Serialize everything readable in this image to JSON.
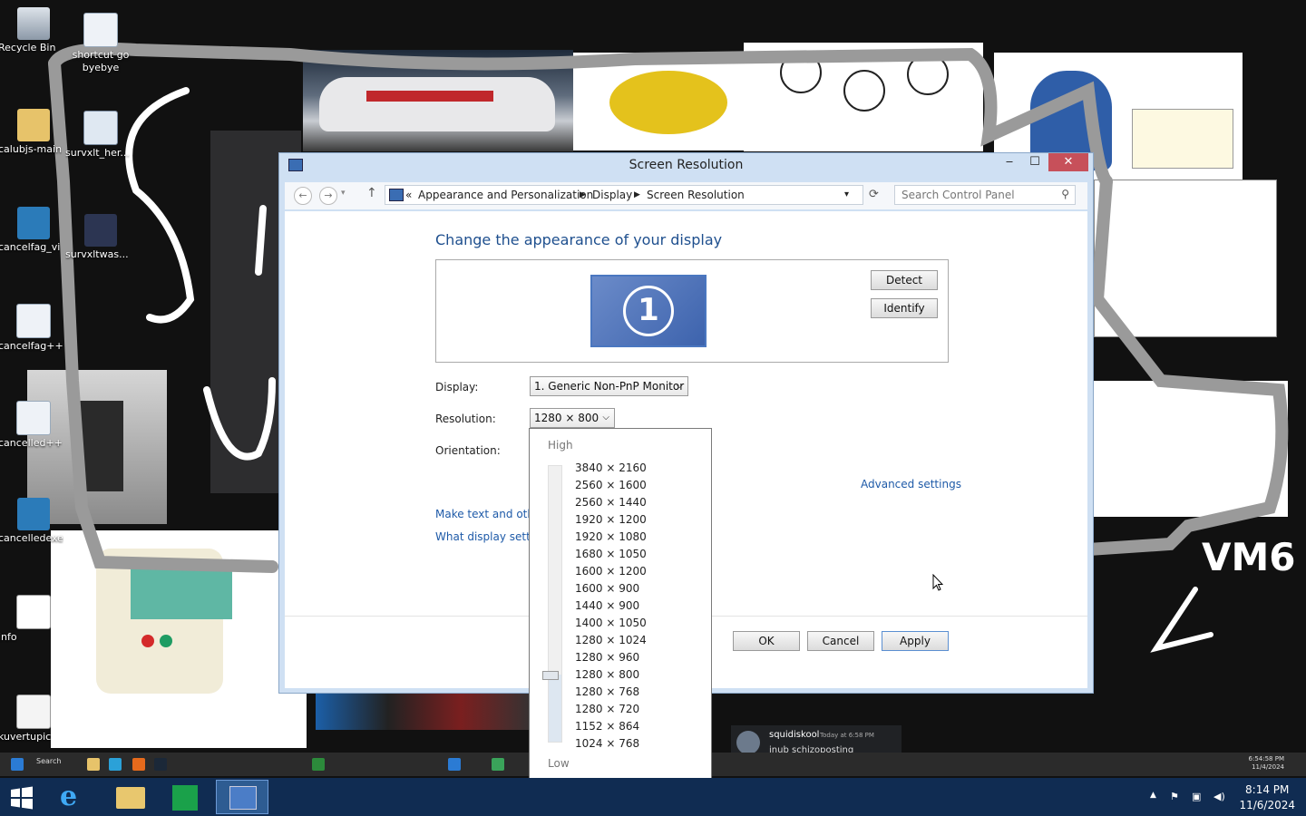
{
  "desktop": {
    "icons": [
      {
        "label": "Recycle Bin",
        "icon": "recycle-bin-icon"
      },
      {
        "label": "shortcut go byebye",
        "icon": "gear-icon"
      },
      {
        "label": "calubjs-main",
        "icon": "folder-icon"
      },
      {
        "label": "survxlt_her...",
        "icon": "file-icon"
      },
      {
        "label": "cancelfag_vi",
        "icon": "app-icon"
      },
      {
        "label": "survxltwas...",
        "icon": "app-icon"
      },
      {
        "label": "cancelfag++",
        "icon": "gear-icon"
      },
      {
        "label": "cancelled++",
        "icon": "gear-icon"
      },
      {
        "label": "cancelledexe",
        "icon": "app-icon"
      },
      {
        "label": "info",
        "icon": "document-icon"
      },
      {
        "label": "kuvertupic",
        "icon": "image-icon"
      }
    ],
    "chat": {
      "name": "squidiskool",
      "time": "Today at 6:58 PM",
      "message": "inub schizoposting"
    },
    "vm6_text": "VM6"
  },
  "window": {
    "title": "Screen Resolution",
    "controls": {
      "minimize": "‒",
      "maximize": "☐",
      "close": "✕"
    },
    "breadcrumb": [
      "Appearance and Personalization",
      "Display",
      "Screen Resolution"
    ],
    "breadcrumb_prefix": "«",
    "search_placeholder": "Search Control Panel",
    "heading": "Change the appearance of your display",
    "monitor_number": "1",
    "detect_label": "Detect",
    "identify_label": "Identify",
    "display_label": "Display:",
    "display_value": "1. Generic Non-PnP Monitor",
    "resolution_label": "Resolution:",
    "resolution_value": "1280 × 800",
    "orientation_label": "Orientation:",
    "advanced_link": "Advanced settings",
    "link_text_size": "Make text and other",
    "link_display_settings": "What display setting",
    "ok_label": "OK",
    "cancel_label": "Cancel",
    "apply_label": "Apply"
  },
  "resolution_dropdown": {
    "high_label": "High",
    "low_label": "Low",
    "selected_index": 12,
    "options": [
      "3840 × 2160",
      "2560 × 1600",
      "2560 × 1440",
      "1920 × 1200",
      "1920 × 1080",
      "1680 × 1050",
      "1600 × 1200",
      "1600 × 900",
      "1440 × 900",
      "1400 × 1050",
      "1280 × 1024",
      "1280 × 960",
      "1280 × 800",
      "1280 × 768",
      "1280 × 720",
      "1152 × 864",
      "1024 × 768"
    ]
  },
  "taskbar": {
    "time": "8:14 PM",
    "date": "11/6/2024",
    "inner_search": "Search",
    "inner_time": "6:54:58 PM",
    "inner_date": "11/4/2024"
  }
}
